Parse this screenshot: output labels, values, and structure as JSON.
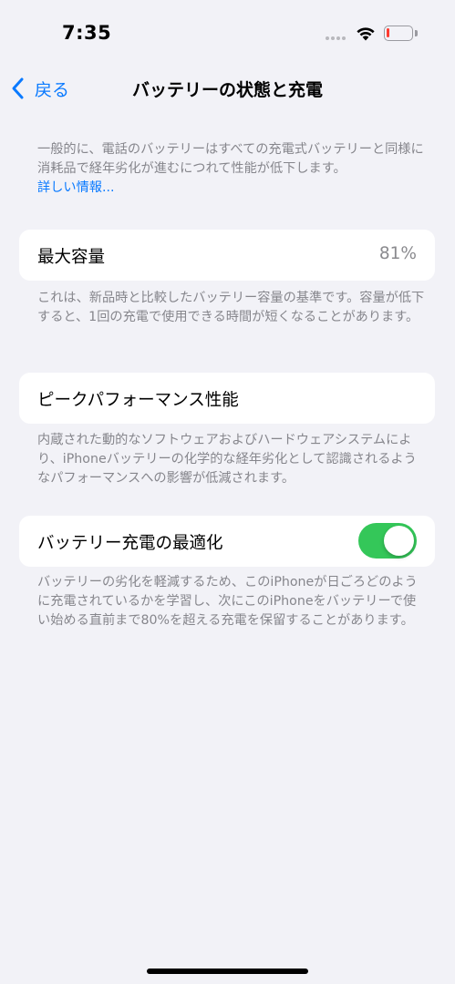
{
  "status_bar": {
    "time": "7:35",
    "battery_level_fraction": 0.12,
    "battery_color": "#ff3b30"
  },
  "nav": {
    "back_label": "戻る",
    "title": "バッテリーの状態と充電"
  },
  "intro": {
    "text": "一般的に、電話のバッテリーはすべての充電式バッテリーと同様に消耗品で経年劣化が進むにつれて性能が低下します。",
    "link": "詳しい情報..."
  },
  "max_capacity": {
    "label": "最大容量",
    "value": "81%",
    "footnote": "これは、新品時と比較したバッテリー容量の基準です。容量が低下すると、1回の充電で使用できる時間が短くなることがあります。"
  },
  "peak_performance": {
    "label": "ピークパフォーマンス性能",
    "footnote": "内蔵された動的なソフトウェアおよびハードウェアシステムにより、iPhoneバッテリーの化学的な経年劣化として認識されるようなパフォーマンスへの影響が低減されます。"
  },
  "optimized_charging": {
    "label": "バッテリー充電の最適化",
    "enabled": true,
    "toggle_color": "#34c759",
    "footnote": "バッテリーの劣化を軽減するため、このiPhoneが日ごろどのように充電されているかを学習し、次にこのiPhoneをバッテリーで使い始める直前まで80%を超える充電を保留することがあります。"
  },
  "accent_color": "#0a7aff"
}
